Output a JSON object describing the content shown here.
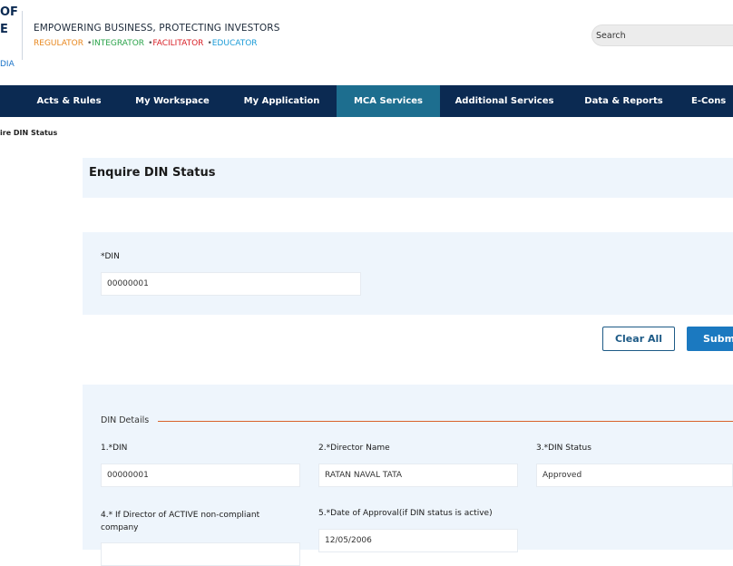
{
  "header": {
    "logo_line1": "OF",
    "logo_line2": "E",
    "logo_line3": "DIA",
    "tagline": "EMPOWERING BUSINESS, PROTECTING INVESTORS",
    "roles": [
      {
        "label": "REGULATOR",
        "color": "#e8871e"
      },
      {
        "label": "INTEGRATOR",
        "color": "#2aa34a"
      },
      {
        "label": "FACILITATOR",
        "color": "#d81f26"
      },
      {
        "label": "EDUCATOR",
        "color": "#1a9bd7"
      }
    ],
    "search_placeholder": "Search"
  },
  "nav": {
    "items": [
      {
        "label": "Acts & Rules"
      },
      {
        "label": "My Workspace"
      },
      {
        "label": "My Application"
      },
      {
        "label": "MCA Services",
        "active": true
      },
      {
        "label": "Additional Services"
      },
      {
        "label": "Data & Reports"
      },
      {
        "label": "E-Cons"
      }
    ]
  },
  "breadcrumb": "ire DIN Status",
  "page_title": "Enquire DIN Status",
  "form": {
    "din_label": "*DIN",
    "din_value": "00000001",
    "clear_label": "Clear All",
    "submit_label": "Submi"
  },
  "details": {
    "section_title": "DIN Details",
    "f1_label": "1.*DIN",
    "f1_value": "00000001",
    "f2_label": "2.*Director Name",
    "f2_value": "RATAN NAVAL TATA",
    "f3_label": "3.*DIN Status",
    "f3_value": "Approved",
    "f4_label_line1": "4.* If Director of ACTIVE non-compliant",
    "f4_label_line2": "company",
    "f4_value": "",
    "f5_label": "5.*Date of Approval(if DIN status is active)",
    "f5_value": "12/05/2006"
  },
  "colors": {
    "nav_bg": "#0b2a52",
    "nav_active": "#1d6e8f",
    "panel_bg": "#eef5fc",
    "submit_bg": "#1b79c0",
    "rule": "#d9622b"
  }
}
